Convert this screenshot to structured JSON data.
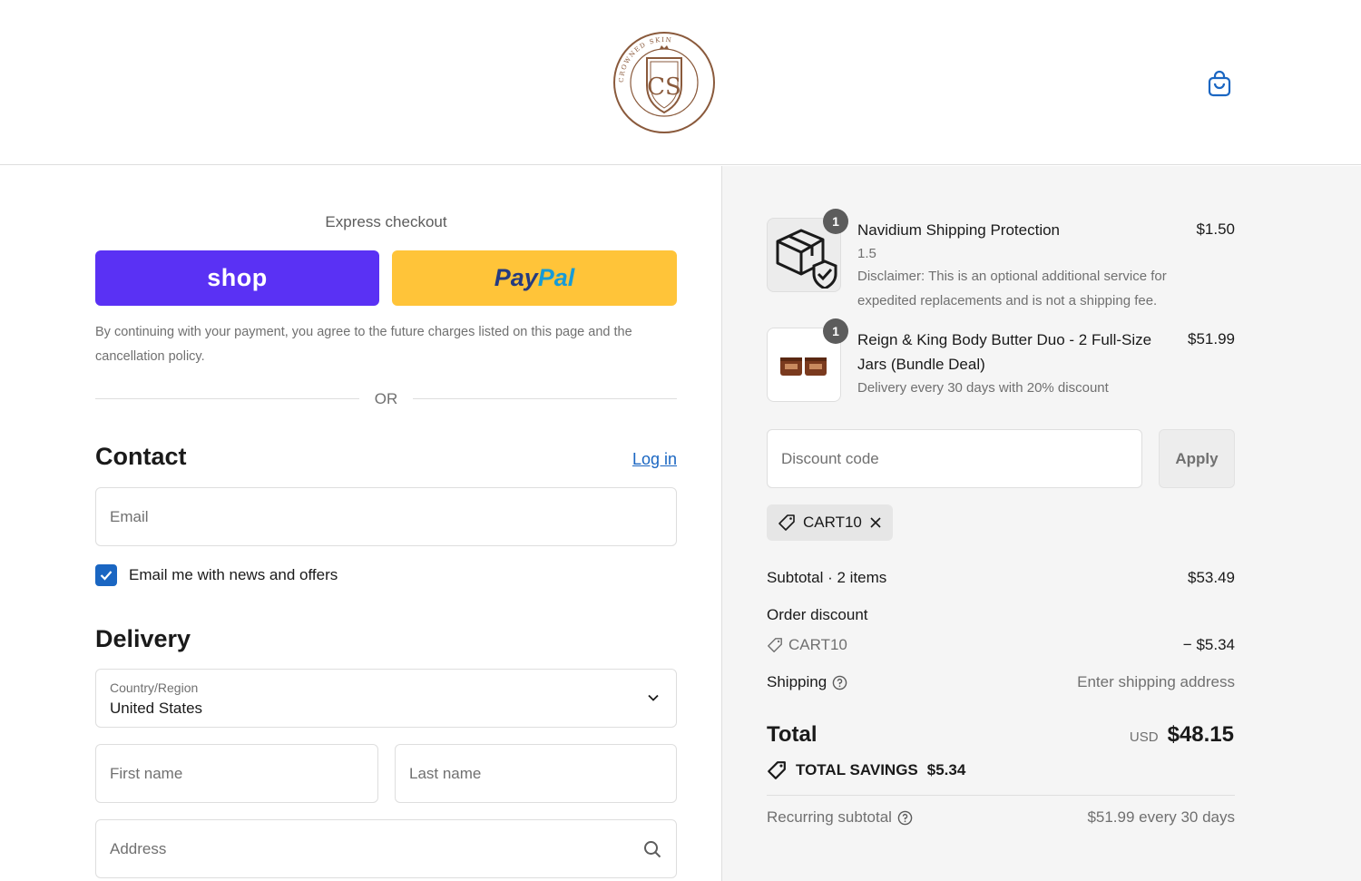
{
  "brand": {
    "logo_ring_text": "CROWNED SKIN",
    "logo_monogram": "CS"
  },
  "express": {
    "title": "Express checkout",
    "shop_label": "shop",
    "paypal_part1": "Pay",
    "paypal_part2": "Pal",
    "disclaimer": "By continuing with your payment, you agree to the future charges listed on this page and the cancellation policy.",
    "or_label": "OR"
  },
  "contact": {
    "heading": "Contact",
    "login_label": "Log in",
    "email_placeholder": "Email",
    "newsletter_label": "Email me with news and offers",
    "newsletter_checked": true
  },
  "delivery": {
    "heading": "Delivery",
    "country_label": "Country/Region",
    "country_value": "United States",
    "first_name_placeholder": "First name",
    "last_name_placeholder": "Last name",
    "address_placeholder": "Address"
  },
  "cart": {
    "items": [
      {
        "qty": "1",
        "name": "Navidium Shipping Protection",
        "price": "$1.50",
        "variant": "1.5",
        "note_line1": "Disclaimer: This is an optional additional service for",
        "note_line2": "expedited replacements and is not a shipping fee."
      },
      {
        "qty": "1",
        "name_line1": "Reign & King Body Butter Duo - 2 Full-Size",
        "name_line2": "Jars (Bundle Deal)",
        "price": "$51.99",
        "note": "Delivery every 30 days with 20% discount"
      }
    ],
    "discount_placeholder": "Discount code",
    "apply_label": "Apply",
    "applied_code": "CART10"
  },
  "summary": {
    "subtotal_label": "Subtotal · 2 items",
    "subtotal_value": "$53.49",
    "order_discount_label": "Order discount",
    "discount_code": "CART10",
    "discount_value": "− $5.34",
    "shipping_label": "Shipping",
    "shipping_value": "Enter shipping address",
    "total_label": "Total",
    "total_currency": "USD",
    "total_value": "$48.15",
    "savings_label": "TOTAL SAVINGS",
    "savings_value": "$5.34",
    "recurring_label": "Recurring subtotal",
    "recurring_value": "$51.99 every 30 days"
  },
  "colors": {
    "shop_purple": "#5a31f4",
    "paypal_yellow": "#ffc439",
    "link_blue": "#1a66c2",
    "logo_brown": "#8a5a3c"
  }
}
